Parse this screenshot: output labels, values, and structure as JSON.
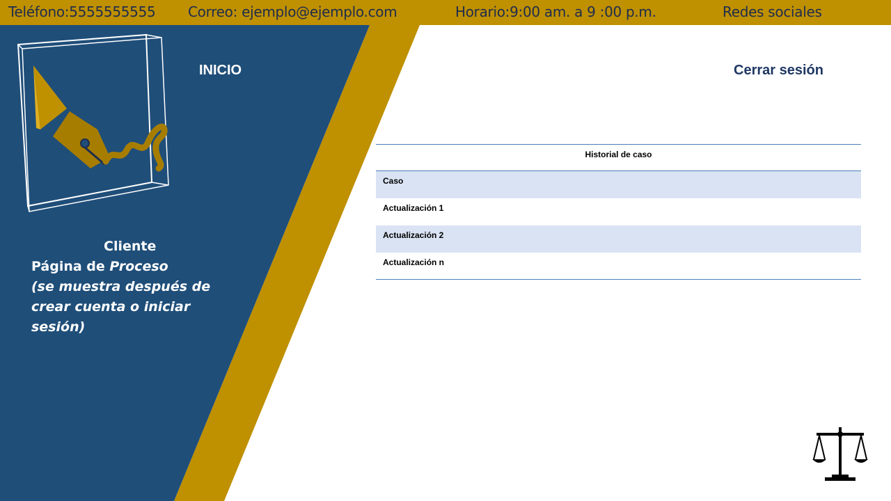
{
  "topbar": {
    "phone": "Teléfono:5555555555",
    "email": "Correo: ejemplo@ejemplo.com",
    "hours": "Horario:9:00 am.  a 9 :00 p.m.",
    "social": "Redes sociales"
  },
  "nav": {
    "home": "INICIO",
    "logout": "Cerrar sesión"
  },
  "side": {
    "role": "Cliente",
    "page_prefix": "Página de ",
    "page_name": "Proceso",
    "note": "(se muestra después de crear cuenta o iniciar sesión)"
  },
  "history": {
    "title": "Historial de caso",
    "rows": [
      "Caso",
      "Actualización 1",
      "Actualización 2",
      "Actualización n"
    ]
  },
  "colors": {
    "navy": "#1f4e79",
    "gold": "#bf9000",
    "accent_text": "#1f3864",
    "row_alt": "#dae3f3"
  },
  "icons": [
    "pen-nib-logo",
    "scales-of-justice-icon"
  ]
}
